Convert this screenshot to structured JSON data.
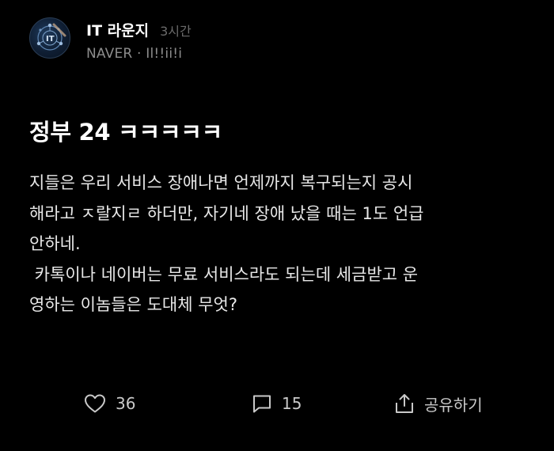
{
  "header": {
    "channel_name": "IT 라운지",
    "time_ago": "3시간",
    "source": "NAVER · Il!!ii!i",
    "avatar_icon": "it-circuit-avatar-icon"
  },
  "post": {
    "title": "정부 24 ㅋㅋㅋㅋㅋ",
    "body_lines": [
      "지들은 우리 서비스 장애나면 언제까지 복구되는지 공시",
      "해라고 ㅈ랄지ㄹ 하더만, 자기네 장애 났을 때는 1도 언급",
      "안하네.",
      " 카톡이나 네이버는 무료 서비스라도 되는데 세금받고 운",
      "영하는 이놈들은 도대체 무엇?"
    ]
  },
  "actions": {
    "like": {
      "icon": "heart-icon",
      "count": "36"
    },
    "comment": {
      "icon": "comment-icon",
      "count": "15"
    },
    "share": {
      "icon": "share-icon",
      "label": "공유하기"
    }
  },
  "colors": {
    "background": "#000000",
    "text_primary": "#ffffff",
    "text_secondary": "#8d8d8d",
    "text_muted": "#6b6b6b"
  }
}
